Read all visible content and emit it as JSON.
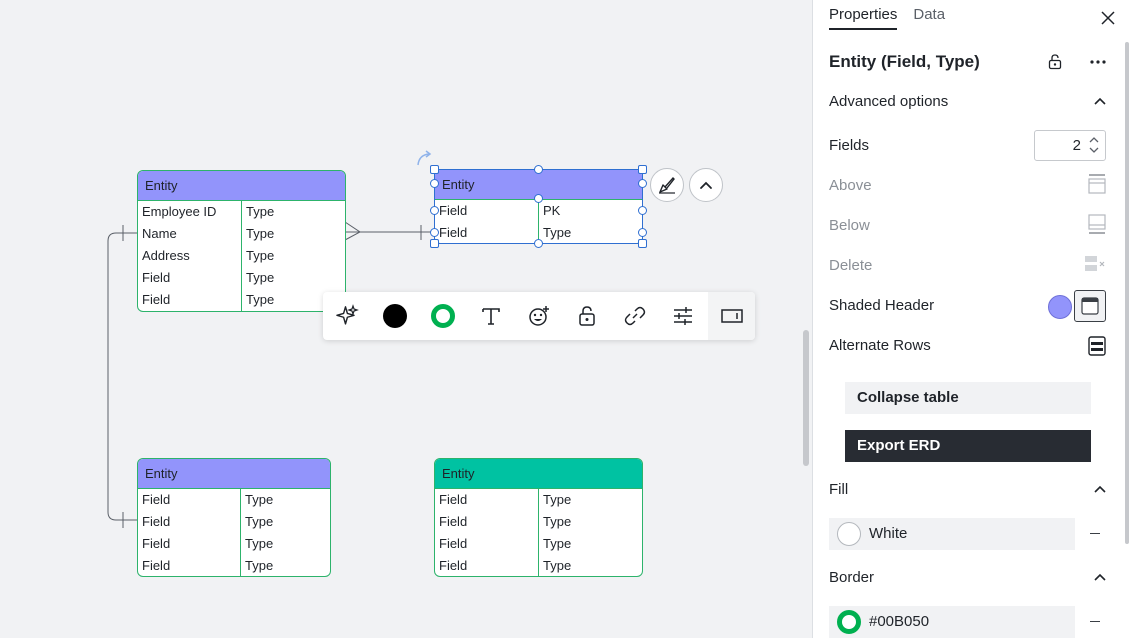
{
  "canvas": {
    "entities": [
      {
        "header": "Entity",
        "rows": [
          {
            "field": "Employee ID",
            "type": "Type"
          },
          {
            "field": "Name",
            "type": "Type"
          },
          {
            "field": "Address",
            "type": "Type"
          },
          {
            "field": "Field",
            "type": "Type"
          },
          {
            "field": "Field",
            "type": "Type"
          }
        ]
      },
      {
        "header": "Entity",
        "rows": [
          {
            "field": "Field",
            "type": "PK"
          },
          {
            "field": "Field",
            "type": "Type"
          }
        ]
      },
      {
        "header": "Entity",
        "rows": [
          {
            "field": "Field",
            "type": "Type"
          },
          {
            "field": "Field",
            "type": "Type"
          },
          {
            "field": "Field",
            "type": "Type"
          },
          {
            "field": "Field",
            "type": "Type"
          }
        ]
      },
      {
        "header": "Entity",
        "rows": [
          {
            "field": "Field",
            "type": "Type"
          },
          {
            "field": "Field",
            "type": "Type"
          },
          {
            "field": "Field",
            "type": "Type"
          },
          {
            "field": "Field",
            "type": "Type"
          }
        ]
      }
    ],
    "toolbar": {
      "items": [
        "sparkle-icon",
        "fill-color-icon",
        "border-color-icon",
        "text-icon",
        "emoji-add-icon",
        "unlock-icon",
        "link-icon",
        "sliders-icon",
        "panel-toggle-icon"
      ],
      "fill_color": "#000000",
      "border_color": "#00B050"
    }
  },
  "panel": {
    "tabs": [
      {
        "label": "Properties",
        "active": true
      },
      {
        "label": "Data",
        "active": false
      }
    ],
    "title": "Entity (Field, Type)",
    "advanced_label": "Advanced options",
    "fields_label": "Fields",
    "fields_value": "2",
    "above_label": "Above",
    "below_label": "Below",
    "delete_label": "Delete",
    "shaded_header_label": "Shaded Header",
    "shaded_header_color": "#9294FB",
    "alternate_rows_label": "Alternate Rows",
    "collapse_label": "Collapse table",
    "export_label": "Export ERD",
    "fill_label": "Fill",
    "fill_value": "White",
    "border_label": "Border",
    "border_value": "#00B050"
  },
  "colors": {
    "entity_header": "#9294FB",
    "entity_header_teal": "#00C2A2",
    "entity_border": "#2DB36B",
    "selection": "#2F6FD1",
    "export_button": "#282C33"
  }
}
